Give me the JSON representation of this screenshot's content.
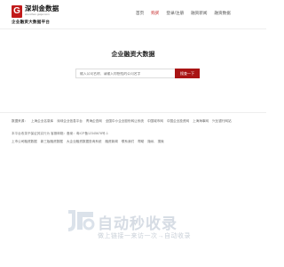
{
  "header": {
    "logo_letter": "G",
    "logo_title": "深圳金数据",
    "logo_subtitle": "shenzhen.gssjw.com",
    "logo_tagline": "企业融资大数据平台",
    "nav": [
      {
        "label": "首页",
        "active": false
      },
      {
        "label": "购买",
        "active": true
      },
      {
        "label": "登录/注册",
        "active": false
      },
      {
        "label": "融资新闻",
        "active": false
      },
      {
        "label": "融资数据",
        "active": false
      }
    ]
  },
  "hero": {
    "title": "企业融资大数据",
    "search_placeholder": "输入公司名称、请输入你想找的公司名字",
    "search_button": "搜查一下"
  },
  "footer": {
    "links_row1": [
      "数据来源：",
      "上海企业名录库",
      "深圳企业信息平台",
      "青海企查网",
      "全国中小企业股份转让系统",
      "中国城市网",
      "中国企业投资网",
      "上海海事网",
      "兴业银行网站"
    ],
    "copyright": "本平台收录不保证其实行为 客服邮箱：备案：粤ICP备12345678号-1",
    "links_row2": [
      "上市公司融资数据",
      "新三板融资数据",
      "大企业融资数据查询系统",
      "融资新闻",
      "联系我们",
      "帮助",
      "隐私",
      "搜索"
    ]
  },
  "watermark": {
    "title": "自动秒收录",
    "subtitle": "做上链接一来访一次→自动收录"
  },
  "colors": {
    "accent": "#c11a1a",
    "button": "#a91414"
  }
}
